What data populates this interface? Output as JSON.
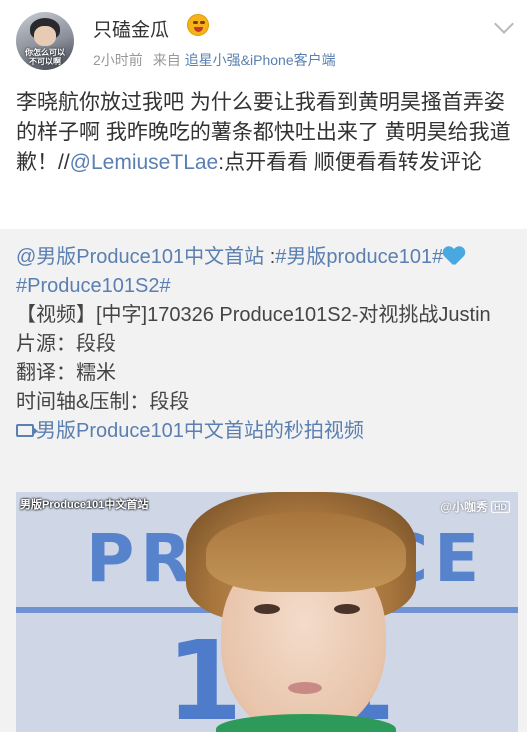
{
  "post": {
    "username": "只磕金瓜",
    "badge_icon": "face-emoji-icon",
    "time": "2小时前",
    "source_prefix": "来自",
    "source": "追星小强&iPhone客户端",
    "avatar_text_line1": "你怎么可以",
    "avatar_text_line2": "不可以啊",
    "text_part1": "李晓航你放过我吧 为什么要让我看到黄明昊搔首弄姿的样子啊 我昨晚吃的薯条都快吐出来了 黄明昊给我道歉！//",
    "mention": "@LemiuseTLae",
    "text_part2": ":点开看看 顺便看看转发评论"
  },
  "retweet": {
    "author": "@男版Produce101中文首站",
    "colon": " :",
    "topic1": "#男版produce101#",
    "topic2": "#Produce101S2#",
    "line1": "【视频】[中字]170326 Produce101S2-对视挑战Justin",
    "line2": "片源：段段",
    "line3": "翻译：糯米",
    "line4": "时间轴&压制：段段",
    "video_link": "男版Produce101中文首站的秒拍视频"
  },
  "video": {
    "label": "男版Produce101中文首站",
    "watermark": "@小咖秀",
    "hd": "HD",
    "bg_letters": "PRODUCE",
    "bg_number": "101"
  },
  "colors": {
    "link": "#5a7fb0",
    "retweet_bg": "#f2f2f2",
    "heart": "#4aa8e0"
  }
}
